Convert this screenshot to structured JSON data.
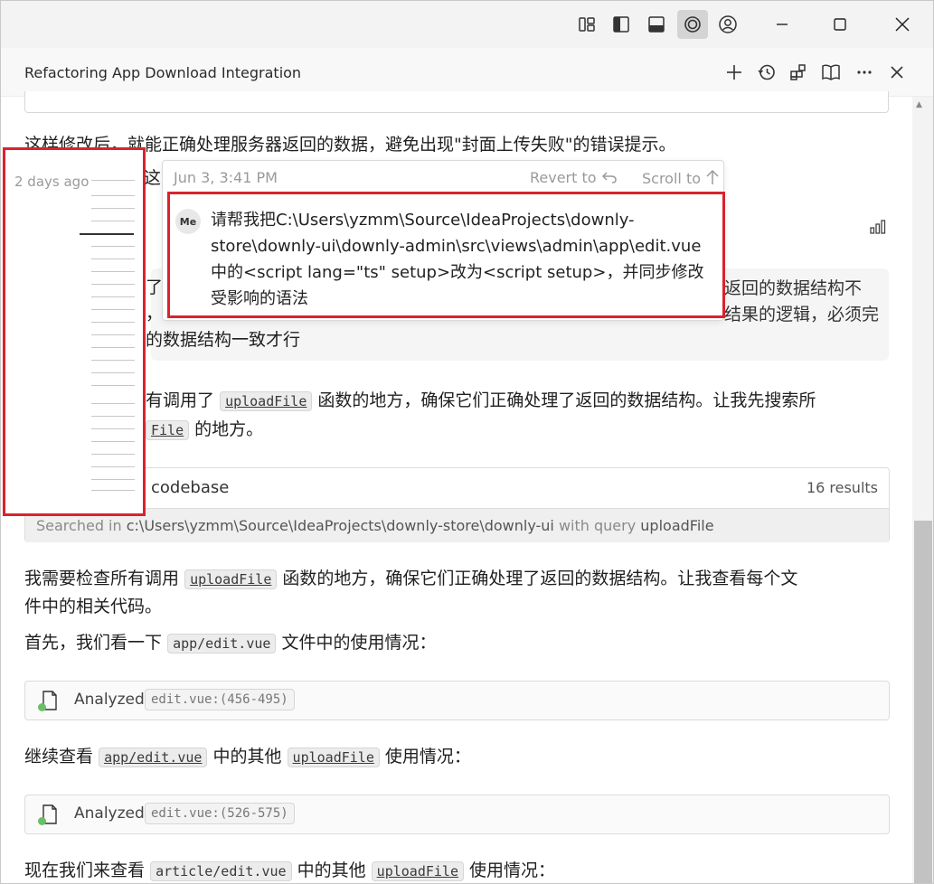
{
  "header": {
    "title": "Refactoring App Download Integration"
  },
  "content": {
    "p_top": "这样修改后，就能正确处理服务器返回的数据，避免出现\"封面上传失败\"的错误提示。",
    "p_top2_tail": "这",
    "grey_right_1": "返回的数据结构不",
    "grey_right_2": "结果的逻辑，必须完",
    "grey_left_1": "了",
    "grey_left_2": "，",
    "grey_left_3": "的数据结构一致才行",
    "p_check_a": "有调用了",
    "p_check_code": "uploadFile",
    "p_check_b": "函数的地方，确保它们正确处理了返回的数据结构。让我先搜索所",
    "p_check_code2": "File",
    "p_check_c": "的地方。",
    "search": {
      "title": "codebase",
      "results": "16 results",
      "foot_prefix": "Searched in",
      "foot_path": "c:\\Users\\yzmm\\Source\\IdeaProjects\\downly-store\\downly-ui",
      "foot_mid": "with query",
      "foot_query": "uploadFile"
    },
    "p2_a": "我需要检查所有调用",
    "p2_code": "uploadFile",
    "p2_b": "函数的地方，确保它们正确处理了返回的数据结构。让我查看每个文",
    "p2_c": "件中的相关代码。",
    "p3_a": "首先，我们看一下",
    "p3_code": "app/edit.vue",
    "p3_b": "文件中的使用情况：",
    "analyzed1_label": "Analyzed",
    "analyzed1_loc": "edit.vue:(456-495)",
    "p4_a": "继续查看",
    "p4_code": "app/edit.vue",
    "p4_b": "中的其他",
    "p4_code2": "uploadFile",
    "p4_c": "使用情况：",
    "analyzed2_label": "Analyzed",
    "analyzed2_loc": "edit.vue:(526-575)",
    "p5_a": "现在我们来查看",
    "p5_code": "article/edit.vue",
    "p5_b": "中的其他",
    "p5_code2": "uploadFile",
    "p5_c": "使用情况："
  },
  "timeline": {
    "when": "2 days ago"
  },
  "popup": {
    "date": "Jun 3, 3:41 PM",
    "revert": "Revert to",
    "scroll": "Scroll to",
    "avatar": "Me",
    "message": "请帮我把C:\\Users\\yzmm\\Source\\IdeaProjects\\downly-store\\downly-ui\\downly-admin\\src\\views\\admin\\app\\edit.vue中的<script lang=\"ts\" setup>改为<script setup>，并同步修改受影响的语法"
  }
}
